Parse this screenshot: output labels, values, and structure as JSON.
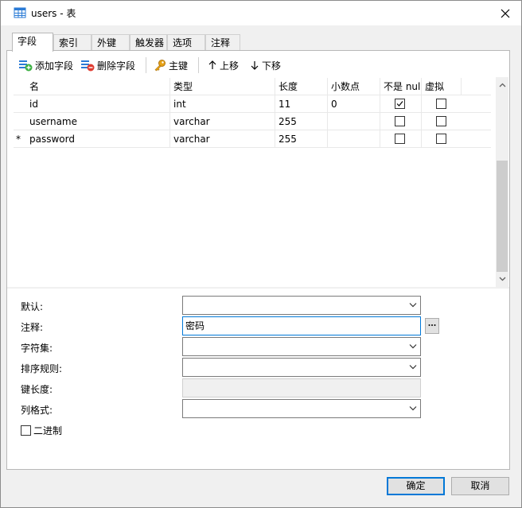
{
  "window": {
    "title": "users - 表",
    "accent_color": "#0078d7"
  },
  "tabs": [
    {
      "label": "字段",
      "active": true
    },
    {
      "label": "索引",
      "active": false
    },
    {
      "label": "外键",
      "active": false
    },
    {
      "label": "触发器",
      "active": false
    },
    {
      "label": "选项",
      "active": false
    },
    {
      "label": "注释",
      "active": false
    }
  ],
  "toolbar": {
    "add_field": "添加字段",
    "delete_field": "删除字段",
    "primary_key": "主键",
    "move_up": "上移",
    "move_down": "下移"
  },
  "grid": {
    "columns": [
      "名",
      "类型",
      "长度",
      "小数点",
      "不是 null",
      "虚拟"
    ],
    "rows": [
      {
        "marker": "",
        "name": "id",
        "type": "int",
        "length": "11",
        "decimals": "0",
        "not_null": true,
        "virtual": false
      },
      {
        "marker": "",
        "name": "username",
        "type": "varchar",
        "length": "255",
        "decimals": "",
        "not_null": false,
        "virtual": false
      },
      {
        "marker": "*",
        "name": "password",
        "type": "varchar",
        "length": "255",
        "decimals": "",
        "not_null": false,
        "virtual": false
      }
    ]
  },
  "properties": {
    "default_label": "默认:",
    "default_value": "",
    "comment_label": "注释:",
    "comment_value": "密码",
    "charset_label": "字符集:",
    "charset_value": "",
    "collation_label": "排序规则:",
    "collation_value": "",
    "key_length_label": "键长度:",
    "key_length_value": "",
    "column_format_label": "列格式:",
    "column_format_value": "",
    "binary_label": "二进制",
    "binary_checked": false
  },
  "footer": {
    "ok_label": "确定",
    "cancel_label": "取消"
  }
}
